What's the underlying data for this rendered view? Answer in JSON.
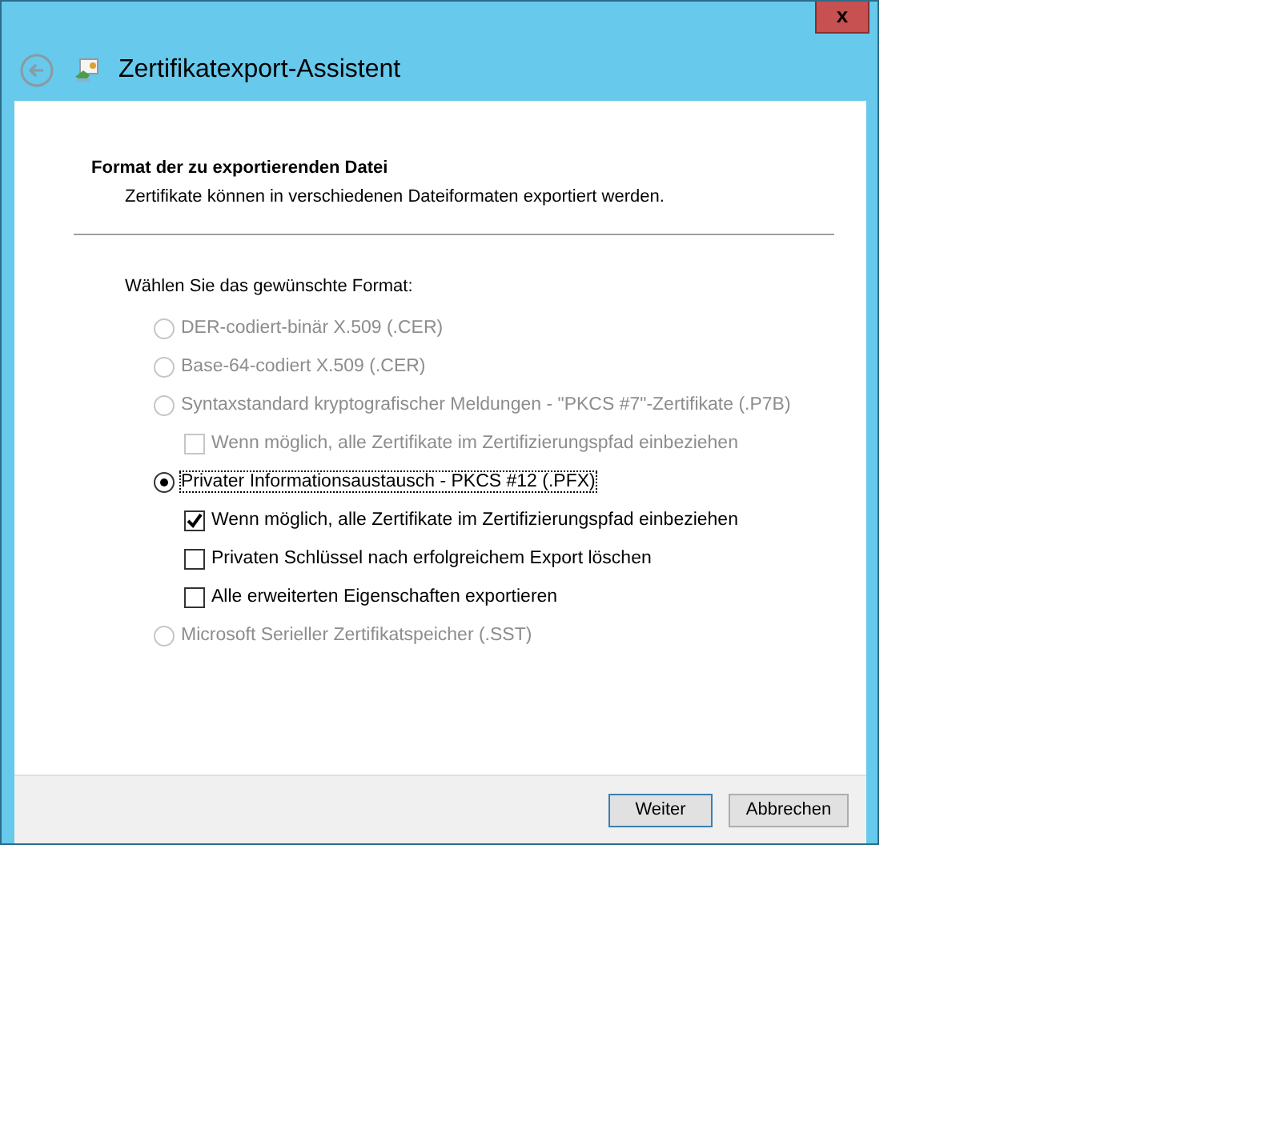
{
  "window": {
    "title": "Zertifikatexport-Assistent",
    "close": "x"
  },
  "header": {
    "title": "Format der zu exportierenden Datei",
    "subtitle": "Zertifikate können in verschiedenen Dateiformaten exportiert werden."
  },
  "prompt": "Wählen Sie das gewünschte Format:",
  "formats": [
    {
      "label": "DER-codiert-binär X.509 (.CER)",
      "selected": false,
      "disabled": true
    },
    {
      "label": "Base-64-codiert X.509 (.CER)",
      "selected": false,
      "disabled": true
    },
    {
      "label": "Syntaxstandard kryptografischer Meldungen - \"PKCS #7\"-Zertifikate (.P7B)",
      "selected": false,
      "disabled": true,
      "options": [
        {
          "label": "Wenn möglich, alle Zertifikate im Zertifizierungspfad einbeziehen",
          "checked": false,
          "disabled": true
        }
      ]
    },
    {
      "label": "Privater Informationsaustausch - PKCS #12 (.PFX)",
      "selected": true,
      "disabled": false,
      "options": [
        {
          "label": "Wenn möglich, alle Zertifikate im Zertifizierungspfad einbeziehen",
          "checked": true,
          "disabled": false
        },
        {
          "label": "Privaten Schlüssel nach erfolgreichem Export löschen",
          "checked": false,
          "disabled": false
        },
        {
          "label": "Alle erweiterten Eigenschaften exportieren",
          "checked": false,
          "disabled": false
        }
      ]
    },
    {
      "label": "Microsoft Serieller Zertifikatspeicher (.SST)",
      "selected": false,
      "disabled": true
    }
  ],
  "buttons": [
    {
      "label": "Weiter",
      "default": true
    },
    {
      "label": "Abbrechen",
      "default": false
    }
  ]
}
